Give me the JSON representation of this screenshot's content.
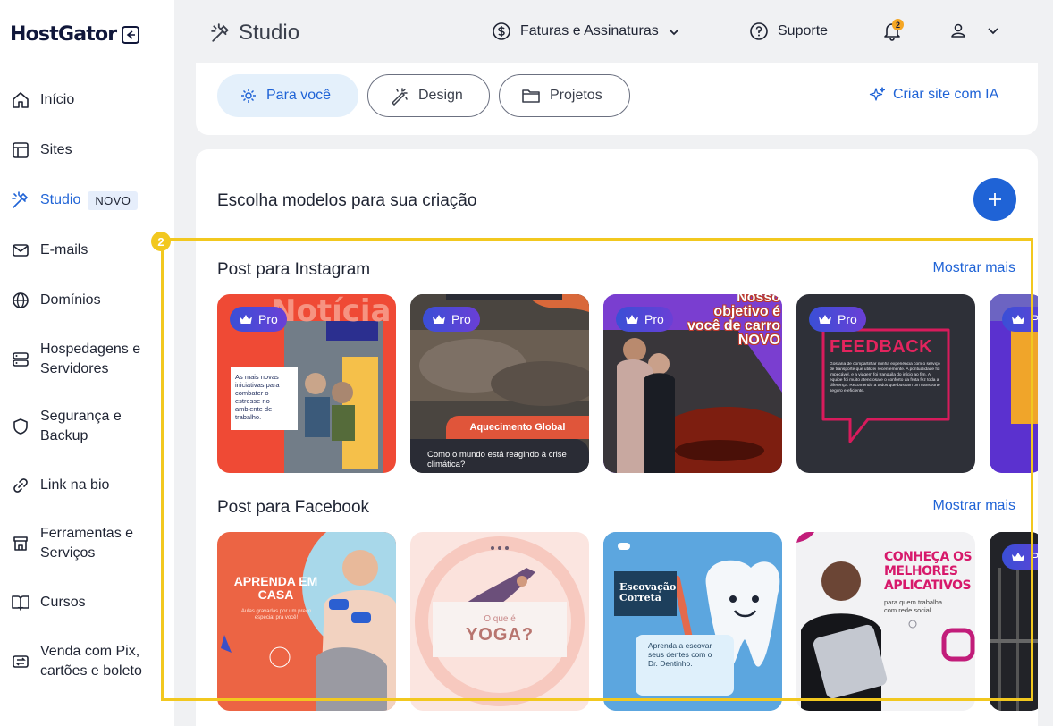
{
  "brand": {
    "name": "HostGator"
  },
  "sidebar": {
    "items": [
      {
        "label": "Início"
      },
      {
        "label": "Sites"
      },
      {
        "label": "Studio",
        "badge": "NOVO"
      },
      {
        "label": "E-mails"
      },
      {
        "label": "Domínios"
      },
      {
        "label": "Hospedagens e",
        "label2": "Servidores"
      },
      {
        "label": "Segurança e",
        "label2": "Backup"
      },
      {
        "label": "Link na bio"
      },
      {
        "label": "Ferramentas e",
        "label2": "Serviços"
      },
      {
        "label": "Cursos"
      },
      {
        "label": "Venda com Pix,",
        "label2": "cartões e boleto"
      }
    ]
  },
  "header": {
    "title": "Studio",
    "billing": "Faturas e Assinaturas",
    "support": "Suporte",
    "notifications_count": "2"
  },
  "tabs": [
    {
      "label": "Para você"
    },
    {
      "label": "Design"
    },
    {
      "label": "Projetos"
    }
  ],
  "create_ai": "Criar site com IA",
  "main": {
    "title": "Escolha modelos para sua criação",
    "show_more": "Mostrar mais",
    "pro_label": "Pro",
    "annotation_number": "2",
    "instagram": {
      "title": "Post para Instagram",
      "cards": [
        {
          "headline": "Notícia",
          "text": "As mais novas iniciativas para combater o estresse no ambiente de trabalho."
        },
        {
          "tag": "Aquecimento Global",
          "text": "Como o mundo está reagindo à crise climática?"
        },
        {
          "headline": "Nosso objetivo é você de carro NOVO"
        },
        {
          "headline": "FEEDBACK",
          "text": "Gostaria de compartilhar minha experiência com o serviço de transporte que utilizei recentemente. A pontualidade foi impecável, e a viagem foi tranquila do início ao fim. A equipe foi muito atenciosa e o conforto da frota fez toda a diferença. Recomendo a todos que buscam um transporte seguro e eficiente."
        },
        {
          "text": ""
        }
      ]
    },
    "facebook": {
      "title": "Post para Facebook",
      "cards": [
        {
          "headline": "APRENDA EM CASA",
          "text": "Aulas gravadas por um preço especial pra você!"
        },
        {
          "small": "O que é",
          "headline": "YOGA?"
        },
        {
          "headline": "Escovação Correta",
          "text": "Aprenda a escovar seus dentes com o Dr. Dentinho."
        },
        {
          "headline": "CONHEÇA OS MELHORES APLICATIVOS",
          "text": "para quem trabalha com rede social."
        },
        {
          "text": ""
        }
      ]
    }
  },
  "colors": {
    "accent": "#1f63d6",
    "highlight": "#f2c81f",
    "pro": "#4a47d6"
  }
}
